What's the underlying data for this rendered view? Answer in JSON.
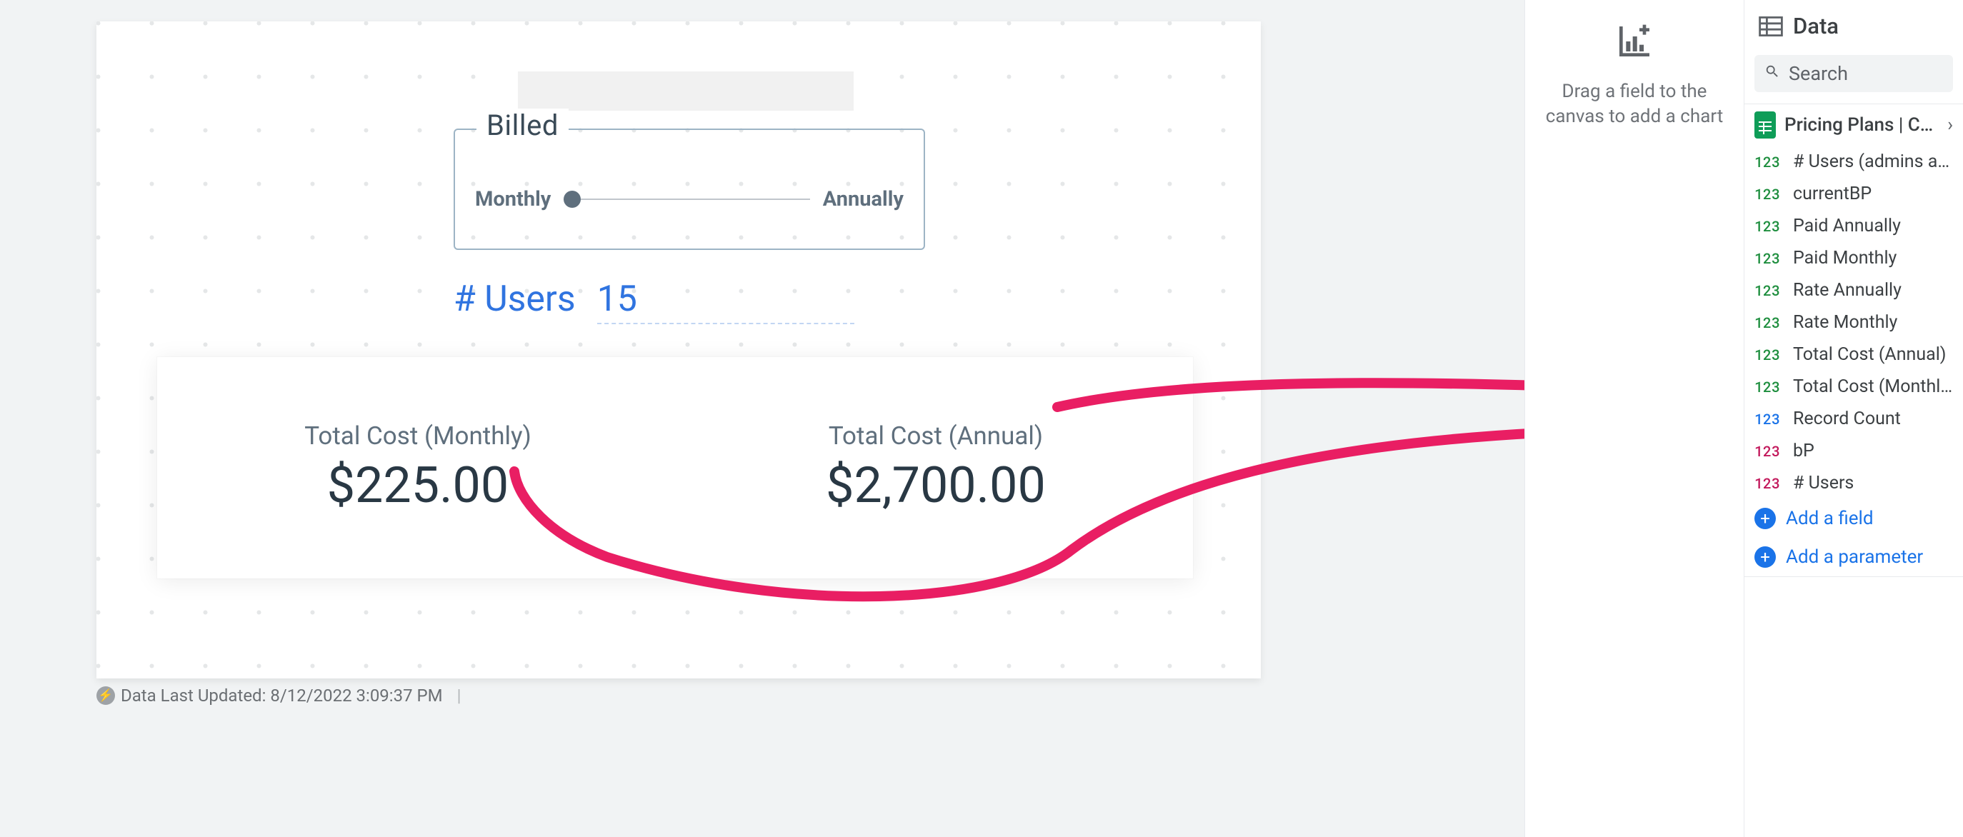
{
  "canvas": {
    "billed_legend": "Billed",
    "billed_option_left": "Monthly",
    "billed_option_right": "Annually",
    "users_label": "# Users",
    "users_value": "15",
    "metric1_title": "Total Cost (Monthly)",
    "metric1_value": "$225.00",
    "metric2_title": "Total Cost (Annual)",
    "metric2_value": "$2,700.00",
    "footer_text": "Data Last Updated: 8/12/2022 3:09:37 PM"
  },
  "dropzone": {
    "hint1": "Drag a field to the",
    "hint2": "canvas to add a chart"
  },
  "data_panel": {
    "title": "Data",
    "search_placeholder": "Search",
    "source_name": "Pricing Plans | Co…",
    "add_field": "Add a field",
    "add_parameter": "Add a parameter",
    "fields": [
      {
        "badge": "123",
        "color": "green",
        "name": "# Users (admins and …"
      },
      {
        "badge": "123",
        "color": "green",
        "name": "currentBP"
      },
      {
        "badge": "123",
        "color": "green",
        "name": "Paid Annually"
      },
      {
        "badge": "123",
        "color": "green",
        "name": "Paid Monthly"
      },
      {
        "badge": "123",
        "color": "green",
        "name": "Rate Annually"
      },
      {
        "badge": "123",
        "color": "green",
        "name": "Rate Monthly"
      },
      {
        "badge": "123",
        "color": "green",
        "name": "Total Cost (Annual)"
      },
      {
        "badge": "123",
        "color": "green",
        "name": "Total Cost (Monthly)"
      },
      {
        "badge": "123",
        "color": "blue",
        "name": "Record Count"
      },
      {
        "badge": "123",
        "color": "pink",
        "name": "bP"
      },
      {
        "badge": "123",
        "color": "pink",
        "name": "# Users"
      }
    ]
  }
}
